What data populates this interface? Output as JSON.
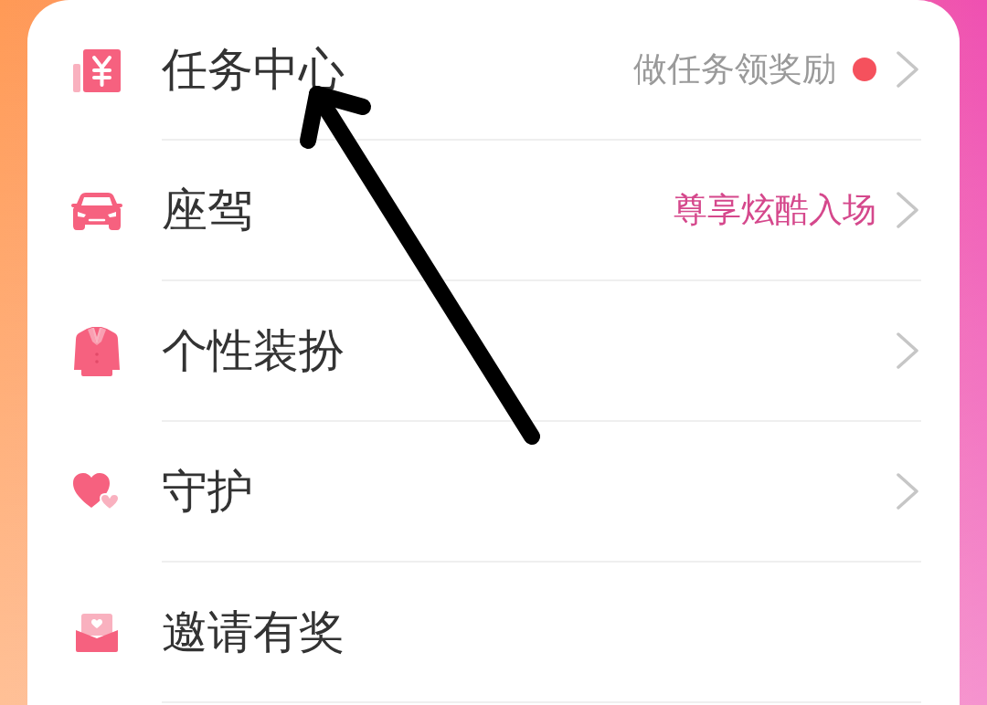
{
  "menu": {
    "items": [
      {
        "label": "任务中心",
        "hint": "做任务领奖励",
        "hint_accent": false,
        "dot": true,
        "chevron": true
      },
      {
        "label": "座驾",
        "hint": "尊享炫酷入场",
        "hint_accent": true,
        "dot": false,
        "chevron": true
      },
      {
        "label": "个性装扮",
        "dot": false,
        "chevron": true
      },
      {
        "label": "守护",
        "dot": false,
        "chevron": true
      },
      {
        "label": "邀请有奖",
        "dot": false,
        "chevron": false
      }
    ]
  }
}
